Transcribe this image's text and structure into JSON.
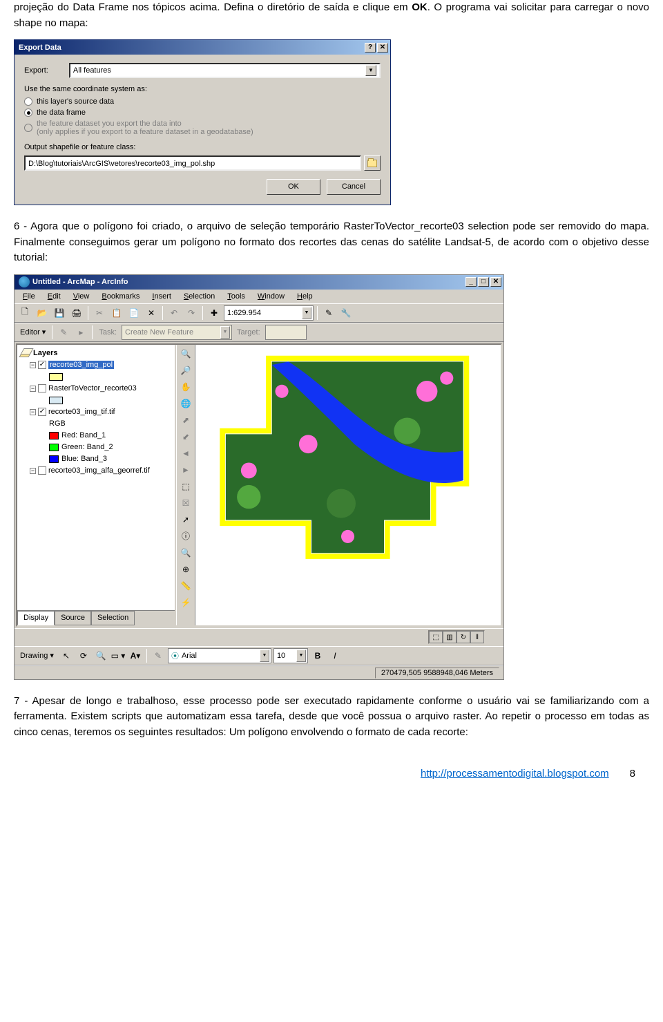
{
  "doc": {
    "p1_a": "projeção do Data Frame nos tópicos acima. Defina o diretório de saída e clique em ",
    "p1_b": "OK",
    "p1_c": ". O programa vai solicitar para carregar o novo shape no mapa:",
    "p2": "6 - Agora que o polígono foi criado, o arquivo de seleção temporário RasterToVector_recorte03 selection pode ser removido do mapa. Finalmente conseguimos gerar um polígono no formato dos recortes das cenas do satélite Landsat-5, de acordo com o objetivo desse tutorial:",
    "p3": "7 - Apesar de longo e trabalhoso, esse processo pode ser executado rapidamente conforme o usuário vai se familiarizando com a ferramenta. Existem scripts que automatizam essa tarefa, desde que você possua o arquivo raster. Ao repetir o processo em todas as cinco cenas, teremos os seguintes resultados: Um polígono envolvendo o formato de cada recorte:"
  },
  "exportDialog": {
    "title": "Export Data",
    "exportLabel": "Export:",
    "exportValue": "All features",
    "coordLabel": "Use the same coordinate system as:",
    "radio1": "this layer's source data",
    "radio2": "the data frame",
    "radio3a": "the feature dataset you export the data into",
    "radio3b": "(only applies if you export to a feature dataset in a geodatabase)",
    "outputLabel": "Output shapefile or feature class:",
    "outputPath": "D:\\Blog\\tutoriais\\ArcGIS\\vetores\\recorte03_img_pol.shp",
    "ok": "OK",
    "cancel": "Cancel"
  },
  "arcmap": {
    "title": "Untitled - ArcMap - ArcInfo",
    "menu": [
      "File",
      "Edit",
      "View",
      "Bookmarks",
      "Insert",
      "Selection",
      "Tools",
      "Window",
      "Help"
    ],
    "scale": "1:629.954",
    "editor": "Editor",
    "taskLabel": "Task:",
    "taskValue": "Create New Feature",
    "targetLabel": "Target:",
    "toc": {
      "layersLabel": "Layers",
      "item1": "recorte03_img_pol",
      "item2": "RasterToVector_recorte03",
      "item3": "recorte03_img_tif.tif",
      "rgb": "RGB",
      "band1": "Red:    Band_1",
      "band2": "Green: Band_2",
      "band3": "Blue:   Band_3",
      "item4": "recorte03_img_alfa_georref.tif",
      "tabs": [
        "Display",
        "Source",
        "Selection"
      ]
    },
    "drawing": "Drawing",
    "font": "Arial",
    "fontSize": "10",
    "status": "270479,505 9588948,046 Meters"
  },
  "footer": {
    "url": "http://processamentodigital.blogspot.com",
    "page": "8"
  }
}
